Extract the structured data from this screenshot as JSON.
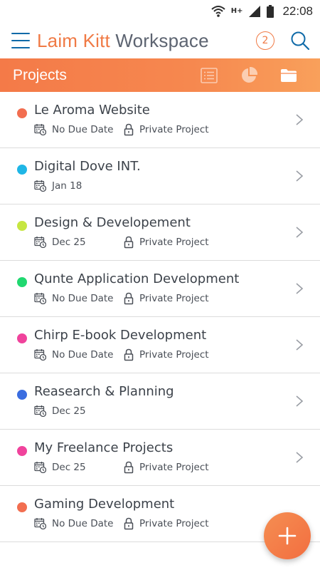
{
  "status_bar": {
    "time": "22:08",
    "network": "H+"
  },
  "app_bar": {
    "title_accent": "Laim Kitt ",
    "title_rest": "Workspace",
    "notification_count": "2"
  },
  "tab_bar": {
    "label": "Projects",
    "views": [
      "list-view-icon",
      "chart-view-icon",
      "folder-view-icon"
    ],
    "active_view": "folder-view-icon"
  },
  "projects": [
    {
      "name": "Le Aroma Website",
      "due": "No Due Date",
      "privacy": "Private Project",
      "color": "#f26e50"
    },
    {
      "name": "Digital Dove INT.",
      "due": "Jan 18",
      "privacy": "",
      "color": "#1fb6e6"
    },
    {
      "name": "Design & Developement",
      "due": "Dec 25",
      "privacy": "Private Project",
      "color": "#c6e641"
    },
    {
      "name": "Qunte Application Development",
      "due": "No Due Date",
      "privacy": "Private Project",
      "color": "#20d870"
    },
    {
      "name": "Chirp E-book Development",
      "due": "No Due Date",
      "privacy": "Private Project",
      "color": "#f0439c"
    },
    {
      "name": "Reasearch & Planning",
      "due": "Dec 25",
      "privacy": "",
      "color": "#3a6de0"
    },
    {
      "name": "My Freelance Projects",
      "due": "Dec 25",
      "privacy": "Private Project",
      "color": "#f0439c"
    },
    {
      "name": "Gaming Development",
      "due": "No Due Date",
      "privacy": "Private Project",
      "color": "#f26e50"
    }
  ],
  "colors": {
    "accent": "#f07a45",
    "brand_blue": "#0f6aa8"
  }
}
